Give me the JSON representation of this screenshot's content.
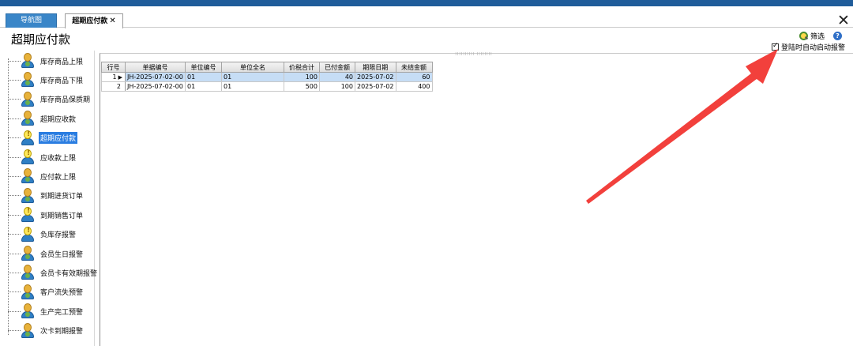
{
  "tabs": [
    {
      "label": "导航图",
      "active": false
    },
    {
      "label": "超期应付款",
      "active": true,
      "close_glyph": "✕"
    }
  ],
  "window_close_glyph": "✕",
  "page_title": "超期应付款",
  "filter": {
    "label": "筛选",
    "icon": "filter-magnifier-icon",
    "help_glyph": "?"
  },
  "auto_alert": {
    "label": "登陆时自动启动报警",
    "checked": true
  },
  "sidebar": {
    "items": [
      {
        "label": "库存商品上限",
        "warn": false
      },
      {
        "label": "库存商品下限",
        "warn": false
      },
      {
        "label": "库存商品保质期",
        "warn": false
      },
      {
        "label": "超期应收款",
        "warn": false
      },
      {
        "label": "超期应付款",
        "warn": true,
        "selected": true
      },
      {
        "label": "应收款上限",
        "warn": true
      },
      {
        "label": "应付款上限",
        "warn": false
      },
      {
        "label": "到期进货订单",
        "warn": false
      },
      {
        "label": "到期销售订单",
        "warn": true
      },
      {
        "label": "负库存报警",
        "warn": true
      },
      {
        "label": "会员生日报警",
        "warn": false
      },
      {
        "label": "会员卡有效期报警",
        "warn": false
      },
      {
        "label": "客户流失预警",
        "warn": false
      },
      {
        "label": "生产完工预警",
        "warn": false
      },
      {
        "label": "次卡到期报警",
        "warn": false
      }
    ]
  },
  "grid": {
    "splitter_text": "IIIIIIIIII   IIIIIIII",
    "columns": [
      "行号",
      "单据编号",
      "单位编号",
      "单位全名",
      "价税合计",
      "已付金额",
      "期限日期",
      "未结金额"
    ],
    "rows": [
      {
        "row_no": "1",
        "pointer": "▶",
        "doc_no": "JH-2025-07-02-00",
        "unit_no": "01",
        "unit_name": "01",
        "total": "100",
        "paid": "40",
        "due_date": "2025-07-02",
        "unsettled": "60",
        "selected": true
      },
      {
        "row_no": "2",
        "pointer": "",
        "doc_no": "JH-2025-07-02-00",
        "unit_no": "01",
        "unit_name": "01",
        "total": "500",
        "paid": "100",
        "due_date": "2025-07-02",
        "unsettled": "400",
        "selected": false
      }
    ]
  },
  "colors": {
    "title_bar": "#1f5c9a",
    "tab_active_bg": "#3a86c8",
    "selection": "#2a7de1",
    "arrow": "#f2403c"
  }
}
